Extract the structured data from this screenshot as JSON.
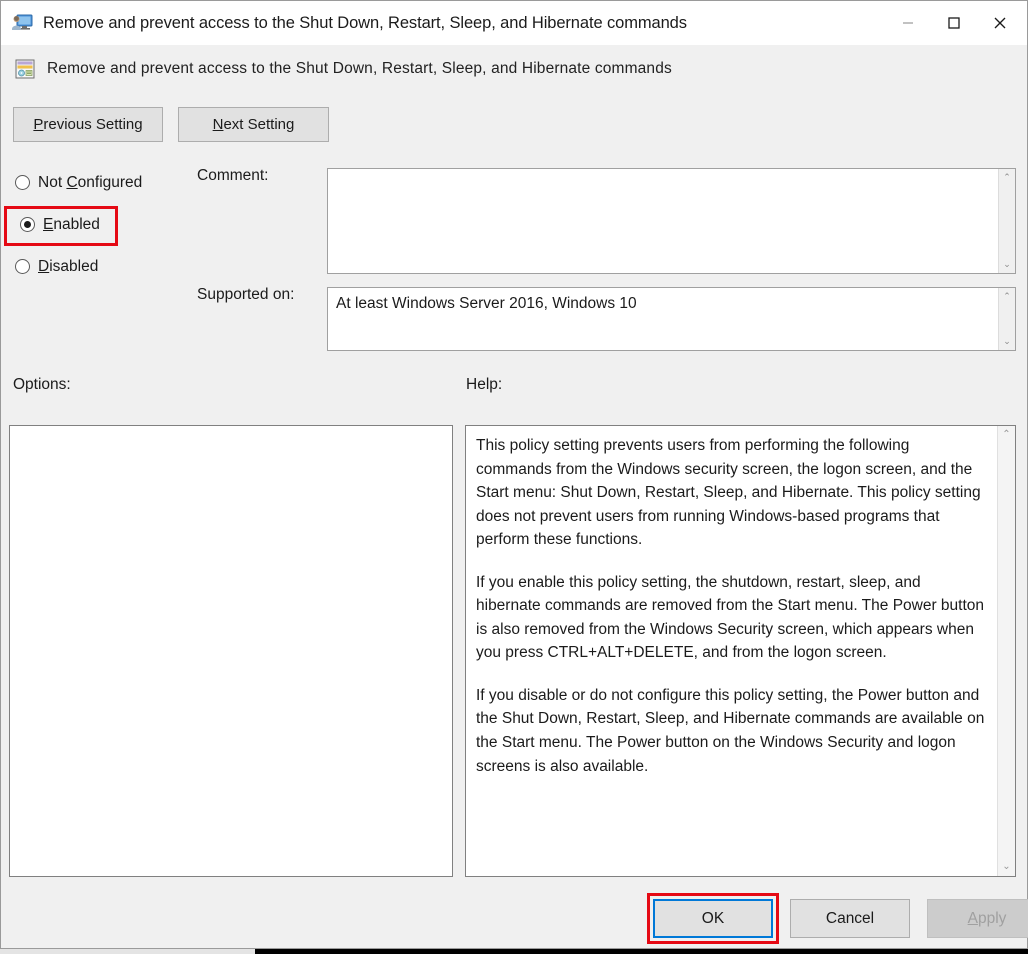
{
  "window": {
    "title": "Remove and prevent access to the Shut Down, Restart, Sleep, and Hibernate commands",
    "title_icon": "user-configuration-monitor-icon",
    "minimize_label": "—",
    "maximize_label": "□",
    "close_label": "✕"
  },
  "header": {
    "icon": "policy-setting-icon",
    "title": "Remove and prevent access to the Shut Down, Restart, Sleep, and Hibernate commands"
  },
  "nav": {
    "previous_accel": "P",
    "previous_rest": "revious Setting",
    "next_accel": "N",
    "next_rest": "ext Setting"
  },
  "state": {
    "options": [
      {
        "id": "not-configured",
        "pre": "Not ",
        "accel": "C",
        "post": "onfigured",
        "checked": false
      },
      {
        "id": "enabled",
        "pre": "",
        "accel": "E",
        "post": "nabled",
        "checked": true
      },
      {
        "id": "disabled",
        "pre": "",
        "accel": "D",
        "post": "isabled",
        "checked": false
      }
    ],
    "selected": "enabled"
  },
  "comment": {
    "label": "Comment:",
    "value": "",
    "placeholder": ""
  },
  "supported": {
    "label": "Supported on:",
    "value": "At least Windows Server 2016, Windows 10"
  },
  "panels": {
    "options_label": "Options:",
    "help_label": "Help:",
    "options_content": "",
    "help_paragraphs": [
      "This policy setting prevents users from performing the following commands from the Windows security screen, the logon screen, and the Start menu: Shut Down, Restart, Sleep, and Hibernate. This policy setting does not prevent users from running Windows-based programs that perform these functions.",
      "If you enable this policy setting, the shutdown, restart, sleep, and hibernate commands are removed from the Start menu. The Power button is also removed from the Windows Security screen, which appears when you press CTRL+ALT+DELETE, and from the logon screen.",
      "If you disable or do not configure this policy setting, the Power button and the Shut Down, Restart, Sleep, and Hibernate commands are available on the Start menu. The Power button on the Windows Security and logon screens is also available."
    ]
  },
  "footer": {
    "ok_label": "OK",
    "cancel_label": "Cancel",
    "apply_accel": "A",
    "apply_rest": "pply",
    "apply_disabled": true
  },
  "scrollbars": {
    "up_arrow": "⌃",
    "down_arrow": "⌄"
  },
  "annotations": {
    "highlight_color": "#e50914",
    "focus_color": "#0078d7",
    "targets": [
      "enabled-radio",
      "ok-button"
    ]
  }
}
